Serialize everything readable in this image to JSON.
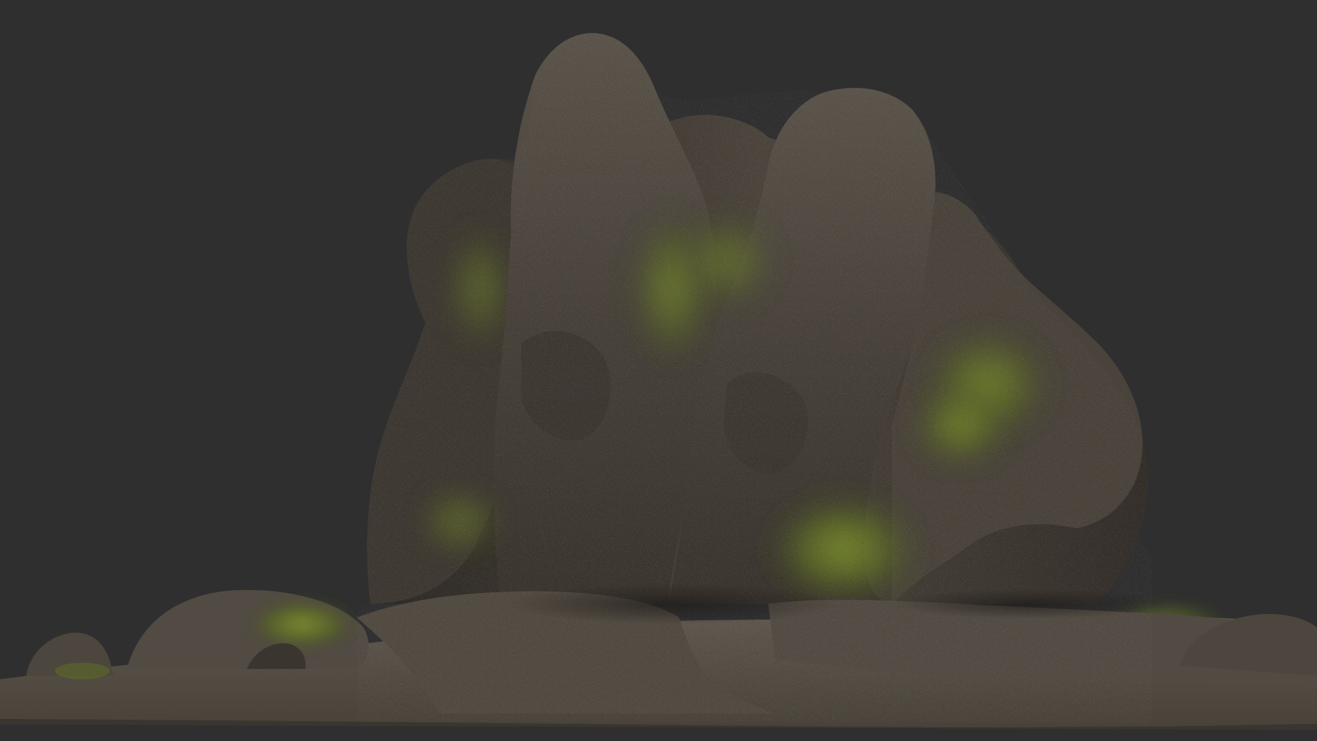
{
  "scene": {
    "subject": "rock-formation",
    "colors": {
      "background": "#2f2f30",
      "rock_dark": "#2e2924",
      "rock_mid": "#4a433b",
      "rock_light": "#6d655a",
      "speckle": "#c9c2b4",
      "moss_dark": "#3f4a1e",
      "moss_light": "#7a8a2e",
      "ground": "#4f4a42",
      "ground_light": "#7a7164"
    }
  }
}
